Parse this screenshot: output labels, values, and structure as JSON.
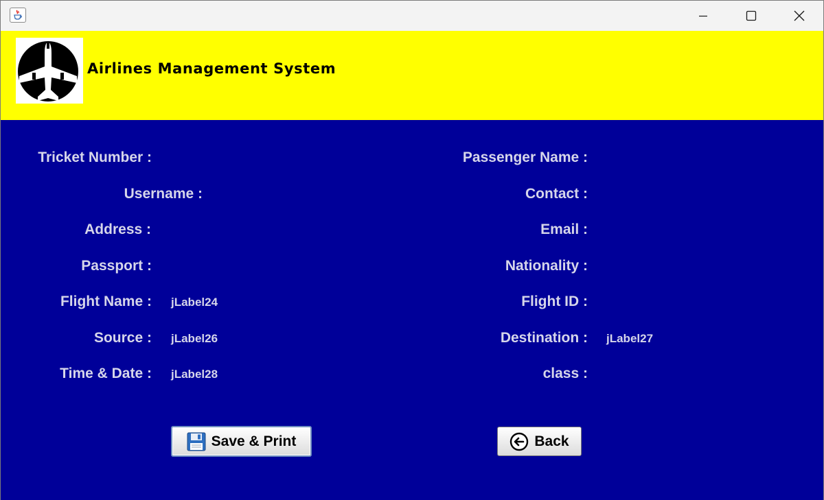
{
  "window": {
    "app_icon": "java-cup-icon",
    "controls": [
      "minimize-icon",
      "maximize-icon",
      "close-icon"
    ]
  },
  "header": {
    "title": "Airlines Management System",
    "logo": "airplane-logo-icon",
    "background": "#ffff00"
  },
  "form": {
    "background": "#000099",
    "left": {
      "ticket_number_label": "Tricket Number :",
      "username_label": "Username :",
      "address_label": "Address :",
      "passport_label": "Passport :",
      "flight_name_label": "Flight Name :",
      "flight_name_value": "jLabel24",
      "source_label": "Source :",
      "source_value": "jLabel26",
      "time_date_label": "Time & Date :",
      "time_date_value": "jLabel28"
    },
    "right": {
      "passenger_name_label": "Passenger Name :",
      "contact_label": "Contact :",
      "email_label": "Email :",
      "nationality_label": "Nationality :",
      "flight_id_label": "Flight ID :",
      "destination_label": "Destination :",
      "destination_value": "jLabel27",
      "class_label": "class :"
    }
  },
  "buttons": {
    "save_print_label": "Save & Print",
    "save_print_icon": "floppy-disk-icon",
    "back_label": "Back",
    "back_icon": "arrow-left-circle-icon"
  }
}
